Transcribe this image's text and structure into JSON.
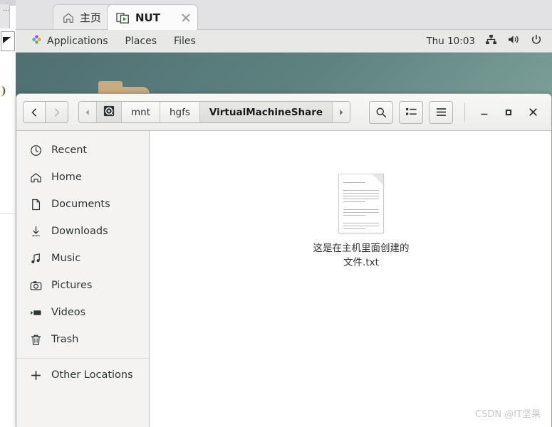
{
  "browser": {
    "tabs": [
      {
        "title": "主页",
        "icon": "home-icon",
        "active": false,
        "close_label": "×"
      },
      {
        "title": "NUT",
        "icon": "app-window-play-icon",
        "active": true,
        "close_label": "×"
      }
    ]
  },
  "gnome_panel": {
    "menus": [
      {
        "label": "Applications",
        "icon": "gnome-applications-icon"
      },
      {
        "label": "Places",
        "icon": ""
      },
      {
        "label": "Files",
        "icon": ""
      }
    ],
    "clock": "Thu 10:03",
    "indicators": [
      {
        "name": "network-icon"
      },
      {
        "name": "volume-icon"
      },
      {
        "name": "power-icon"
      }
    ]
  },
  "file_manager": {
    "nav": {
      "back_label": "Back",
      "forward_label": "Forward"
    },
    "breadcrumbs": {
      "scroll_left": "◂",
      "scroll_right": "▸",
      "items": [
        {
          "label": "",
          "icon": "drive-harddisk-icon",
          "current": false
        },
        {
          "label": "mnt",
          "icon": "",
          "current": false
        },
        {
          "label": "hgfs",
          "icon": "",
          "current": false
        },
        {
          "label": "VirtualMachineShare",
          "icon": "",
          "current": true
        }
      ]
    },
    "header_buttons": [
      {
        "name": "search-button",
        "icon": "search-icon"
      },
      {
        "name": "view-toggle-button",
        "icon": "list-view-icon"
      },
      {
        "name": "menu-button",
        "icon": "hamburger-menu-icon"
      }
    ],
    "window_controls": [
      {
        "name": "minimize-button",
        "icon": "minimize-icon"
      },
      {
        "name": "maximize-button",
        "icon": "maximize-icon"
      },
      {
        "name": "close-button",
        "icon": "close-icon"
      }
    ],
    "sidebar": {
      "items": [
        {
          "label": "Recent",
          "icon": "clock-icon"
        },
        {
          "label": "Home",
          "icon": "home-icon"
        },
        {
          "label": "Documents",
          "icon": "document-icon"
        },
        {
          "label": "Downloads",
          "icon": "download-icon"
        },
        {
          "label": "Music",
          "icon": "music-note-icon"
        },
        {
          "label": "Pictures",
          "icon": "camera-icon"
        },
        {
          "label": "Videos",
          "icon": "video-icon"
        },
        {
          "label": "Trash",
          "icon": "trash-icon"
        }
      ],
      "other_locations": {
        "label": "Other Locations",
        "icon": "plus-icon"
      }
    },
    "files": [
      {
        "name": "这是在主机里面创建的文件.txt",
        "icon": "text-file-icon"
      }
    ]
  },
  "watermark": "CSDN @IT坚果",
  "colors": {
    "desktop_gradient_start": "#4f6f73",
    "desktop_gradient_end": "#9bbdb1",
    "panel_bg": "#e8e8e6",
    "sidebar_bg": "#f4f3f1",
    "accent_green": "#3a9a27"
  }
}
